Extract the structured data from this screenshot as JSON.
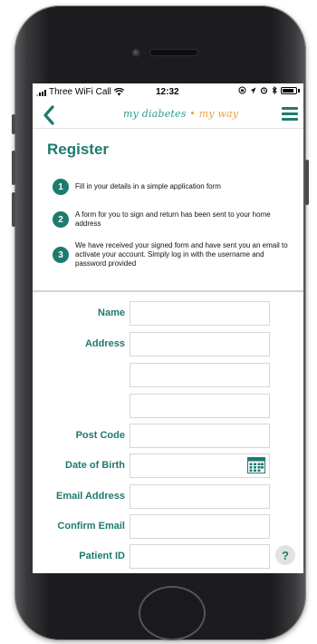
{
  "status_bar": {
    "carrier": "Three WiFi Call",
    "time": "12:32"
  },
  "nav": {
    "logo_part1": "my diabetes",
    "logo_sep": "•",
    "logo_part2": "my way",
    "back_icon": "chevron-left-icon",
    "menu_icon": "hamburger-menu-icon"
  },
  "page": {
    "title": "Register"
  },
  "steps": [
    {
      "num": "1",
      "text": "Fill in your details in a simple application form"
    },
    {
      "num": "2",
      "text": "A form for you to sign and return has been sent to your home address"
    },
    {
      "num": "3",
      "text": "We have received your signed form and have sent you an email to activate your account. Simply log in with the username and password provided"
    }
  ],
  "form": {
    "name_label": "Name",
    "address_label": "Address",
    "postcode_label": "Post Code",
    "dob_label": "Date of Birth",
    "email_label": "Email Address",
    "confirm_email_label": "Confirm Email",
    "patient_id_label": "Patient ID",
    "help_symbol": "?",
    "name_value": "",
    "address_line1_value": "",
    "address_line2_value": "",
    "address_line3_value": "",
    "postcode_value": "",
    "dob_value": "",
    "email_value": "",
    "confirm_email_value": "",
    "patient_id_value": ""
  },
  "colors": {
    "brand_teal": "#1f7a6e",
    "accent_orange": "#e8a33d"
  }
}
